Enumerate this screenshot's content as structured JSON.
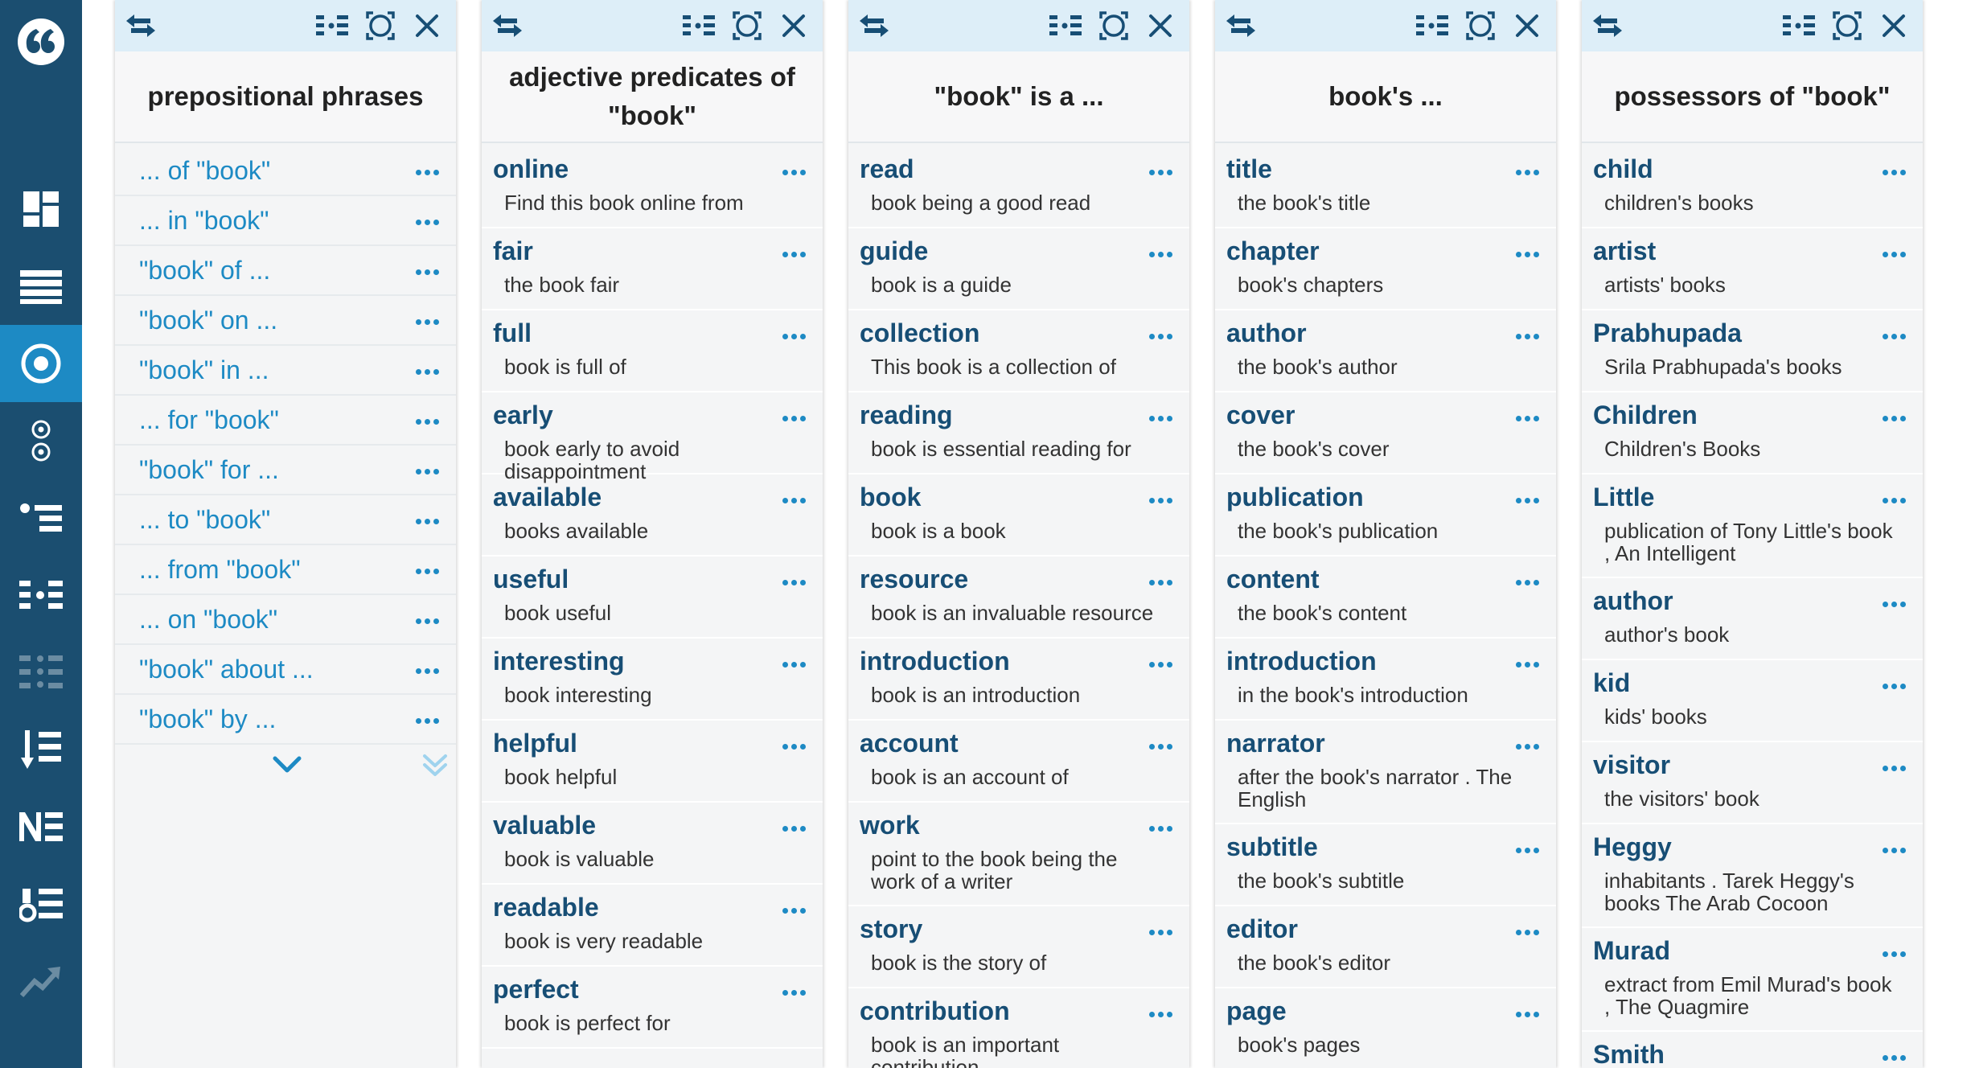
{
  "sidebar": {
    "logo_icon": "quote-logo-icon",
    "items": [
      {
        "icon": "dashboard-icon"
      },
      {
        "icon": "list-icon"
      },
      {
        "icon": "target-icon",
        "active": true
      },
      {
        "icon": "targets-vertical-icon"
      },
      {
        "icon": "bullet-list-icon"
      },
      {
        "icon": "dot-grid-icon"
      },
      {
        "icon": "dot-grid-faded-icon"
      },
      {
        "icon": "sort-icon"
      },
      {
        "icon": "ne-icon",
        "label": "NE"
      },
      {
        "icon": "numbered-list-icon"
      },
      {
        "icon": "trend-icon"
      }
    ]
  },
  "colors": {
    "sidebar_bg": "#1b4e70",
    "accent": "#1d8ac4",
    "word": "#174e75",
    "toolbar_bg": "#ddeef8"
  },
  "columns": [
    {
      "title": "prepositional phrases",
      "kind": "phrases",
      "items": [
        "... of \"book\"",
        "... in \"book\"",
        "\"book\" of ...",
        "\"book\" on ...",
        "\"book\" in ...",
        "... for \"book\"",
        "\"book\" for ...",
        "... to \"book\"",
        "... from \"book\"",
        "... on \"book\"",
        "\"book\" about ...",
        "\"book\" by ..."
      ]
    },
    {
      "title": "adjective predicates of \"book\"",
      "kind": "entries",
      "items": [
        {
          "word": "online",
          "example": "Find this book online from"
        },
        {
          "word": "fair",
          "example": "the book fair"
        },
        {
          "word": "full",
          "example": "book is full of"
        },
        {
          "word": "early",
          "example": "book early to avoid disappointment"
        },
        {
          "word": "available",
          "example": "books available"
        },
        {
          "word": "useful",
          "example": "book useful"
        },
        {
          "word": "interesting",
          "example": "book interesting"
        },
        {
          "word": "helpful",
          "example": "book helpful"
        },
        {
          "word": "valuable",
          "example": "book is valuable"
        },
        {
          "word": "readable",
          "example": "book is very readable"
        },
        {
          "word": "perfect",
          "example": "book is perfect for"
        }
      ]
    },
    {
      "title": "\"book\" is a ...",
      "kind": "entries",
      "items": [
        {
          "word": "read",
          "example": "book being a good read"
        },
        {
          "word": "guide",
          "example": "book is a guide"
        },
        {
          "word": "collection",
          "example": "This book is a collection of"
        },
        {
          "word": "reading",
          "example": "book is essential reading for"
        },
        {
          "word": "book",
          "example": "book is a book"
        },
        {
          "word": "resource",
          "example": "book is an invaluable resource"
        },
        {
          "word": "introduction",
          "example": "book is an introduction"
        },
        {
          "word": "account",
          "example": "book is an account of"
        },
        {
          "word": "work",
          "example": "point to the book being the work of a writer"
        },
        {
          "word": "story",
          "example": "book is the story of"
        },
        {
          "word": "contribution",
          "example": "book is an important contribution"
        }
      ]
    },
    {
      "title": "book's ...",
      "kind": "entries",
      "items": [
        {
          "word": "title",
          "example": "the book's title"
        },
        {
          "word": "chapter",
          "example": "book's chapters"
        },
        {
          "word": "author",
          "example": "the book's author"
        },
        {
          "word": "cover",
          "example": "the book's cover"
        },
        {
          "word": "publication",
          "example": "the book's publication"
        },
        {
          "word": "content",
          "example": "the book's content"
        },
        {
          "word": "introduction",
          "example": "in the book's introduction"
        },
        {
          "word": "narrator",
          "example": "after the book's narrator . The English"
        },
        {
          "word": "subtitle",
          "example": "the book's subtitle"
        },
        {
          "word": "editor",
          "example": "the book's editor"
        },
        {
          "word": "page",
          "example": "book's pages"
        }
      ]
    },
    {
      "title": "possessors of \"book\"",
      "kind": "entries",
      "items": [
        {
          "word": "child",
          "example": "children's books"
        },
        {
          "word": "artist",
          "example": "artists' books"
        },
        {
          "word": "Prabhupada",
          "example": "Srila Prabhupada's books"
        },
        {
          "word": "Children",
          "example": "Children's Books"
        },
        {
          "word": "Little",
          "example": "publication of Tony Little's book , An Intelligent"
        },
        {
          "word": "author",
          "example": "author's book"
        },
        {
          "word": "kid",
          "example": "kids' books"
        },
        {
          "word": "visitor",
          "example": "the visitors' book"
        },
        {
          "word": "Heggy",
          "example": "inhabitants . Tarek Heggy's books The Arab Cocoon"
        },
        {
          "word": "Murad",
          "example": "extract from Emil Murad's book , The Quagmire"
        },
        {
          "word": "Smith",
          "example": ""
        }
      ]
    }
  ]
}
